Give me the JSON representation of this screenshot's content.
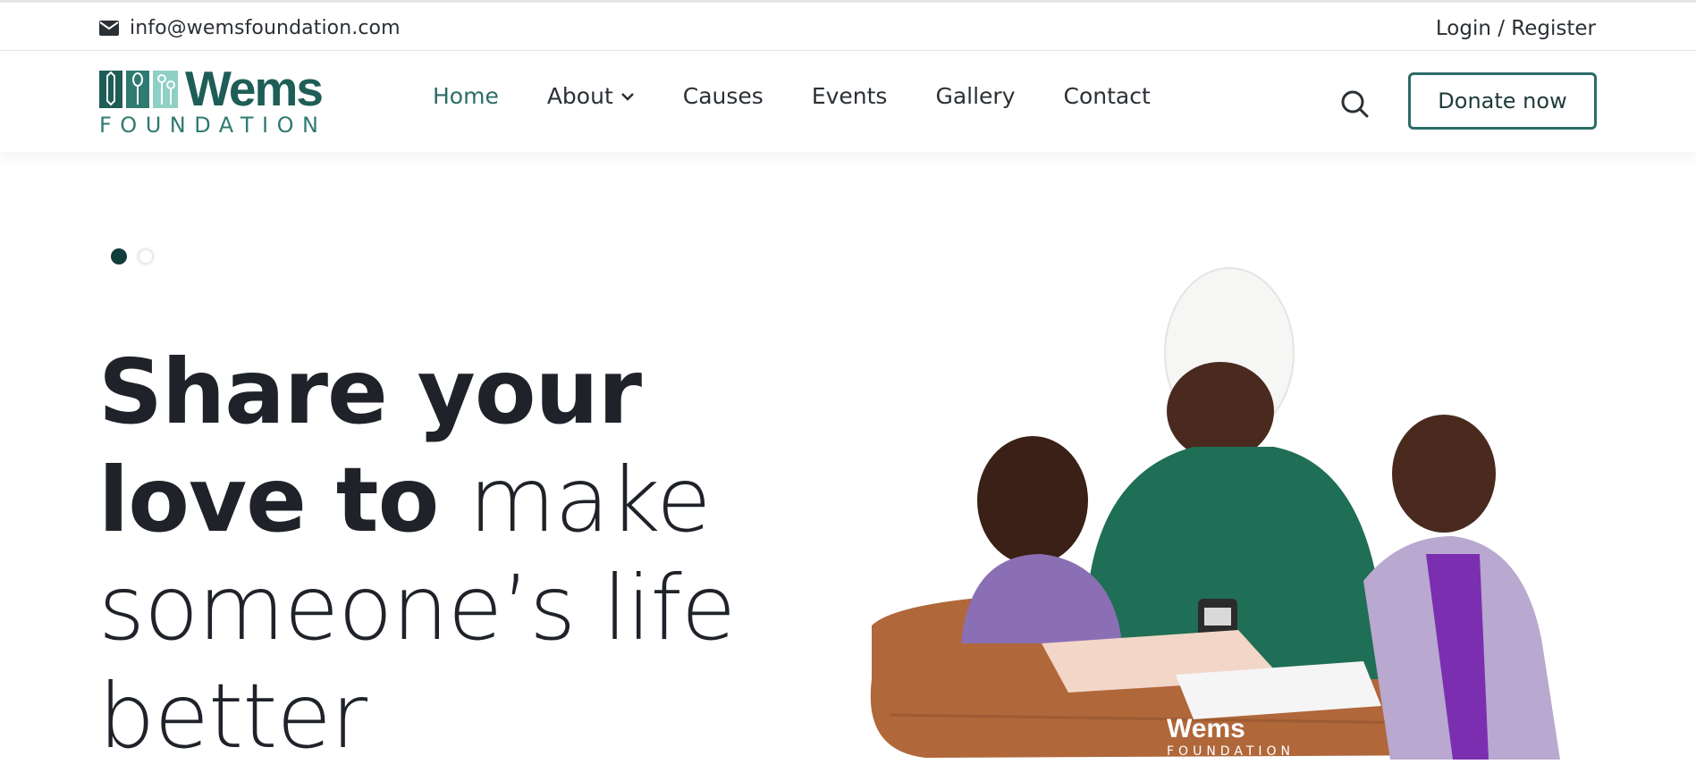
{
  "topbar": {
    "email": "info@wemsfoundation.com",
    "email_icon": "envelope-icon",
    "login": "Login / Register"
  },
  "logo": {
    "word": "Wems",
    "sub": "FOUNDATION"
  },
  "nav": {
    "items": [
      {
        "label": "Home",
        "active": true
      },
      {
        "label": "About",
        "has_dropdown": true
      },
      {
        "label": "Causes"
      },
      {
        "label": "Events"
      },
      {
        "label": "Gallery"
      },
      {
        "label": "Contact"
      }
    ],
    "search_icon": "search-icon",
    "donate_label": "Donate now"
  },
  "hero": {
    "slides_total": 2,
    "active_slide": 1,
    "headline_parts": {
      "bold_1": "Share",
      "bold_2": "your",
      "bold_3": "love to",
      "light_1": "make",
      "light_2": "someone’s life",
      "light_3": "better"
    },
    "image_badge": {
      "word": "Wems",
      "sub": "FOUNDATION"
    }
  },
  "colors": {
    "brand": "#2c6d66",
    "brand_dark": "#113d3b",
    "highlight": "#c5e9df",
    "text": "#1f2329"
  }
}
